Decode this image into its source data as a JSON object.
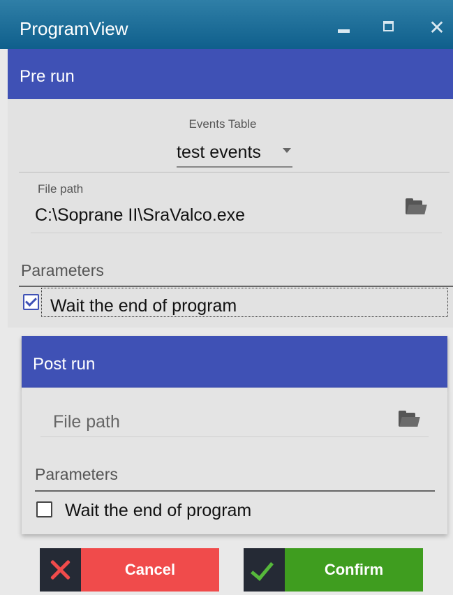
{
  "window": {
    "title": "ProgramView",
    "min_icon": "minimize-icon",
    "max_icon": "maximize-icon",
    "close_icon": "close-icon",
    "close_glyph": "✕"
  },
  "pre_run": {
    "header": "Pre run",
    "events_table": {
      "label": "Events Table",
      "value": "test events"
    },
    "file_path": {
      "label": "File path",
      "value": "C:\\Soprane II\\SraValco.exe",
      "icon": "folder-open-icon"
    },
    "parameters_label": "Parameters",
    "wait_checkbox": {
      "label": "Wait the end of program",
      "checked": true
    }
  },
  "post_run": {
    "header": "Post run",
    "file_path": {
      "placeholder": "File path",
      "icon": "folder-open-icon"
    },
    "parameters_label": "Parameters",
    "wait_checkbox": {
      "label": "Wait the end of program",
      "checked": false
    }
  },
  "buttons": {
    "cancel": {
      "label": "Cancel",
      "icon": "x-icon"
    },
    "confirm": {
      "label": "Confirm",
      "icon": "checkmark-icon"
    }
  },
  "colors": {
    "header": "#3f51b5",
    "titlebar": "#1a6d98",
    "cancel": "#f04b4b",
    "confirm": "#3f9d1f",
    "icon_bg": "#252a35"
  }
}
